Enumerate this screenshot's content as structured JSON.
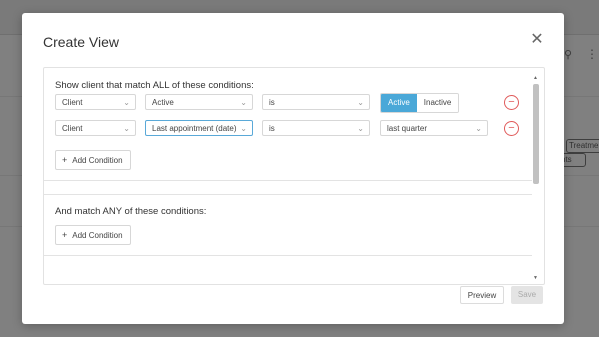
{
  "background": {
    "chip_1": "Treatments",
    "chip_2": "nts",
    "search_icon": "search-icon",
    "more_icon": "more-vertical-icon"
  },
  "modal": {
    "title": "Create View",
    "close_icon": "close-icon",
    "all_section": {
      "title": "Show client that match ALL of these conditions:",
      "rows": [
        {
          "field": "Client",
          "attribute": "Active",
          "operator": "is",
          "toggle": {
            "selected": "Active",
            "other": "Inactive"
          }
        },
        {
          "field": "Client",
          "attribute": "Last appointment (date)",
          "operator": "is",
          "value": "last quarter"
        }
      ],
      "add_label": "Add Condition"
    },
    "any_section": {
      "title": "And match ANY of these conditions:",
      "add_label": "Add Condition"
    },
    "footer": {
      "preview_label": "Preview",
      "save_label": "Save"
    }
  },
  "colors": {
    "accent": "#4aa8d8",
    "danger": "#e05a5a",
    "overlay": "#808080"
  }
}
